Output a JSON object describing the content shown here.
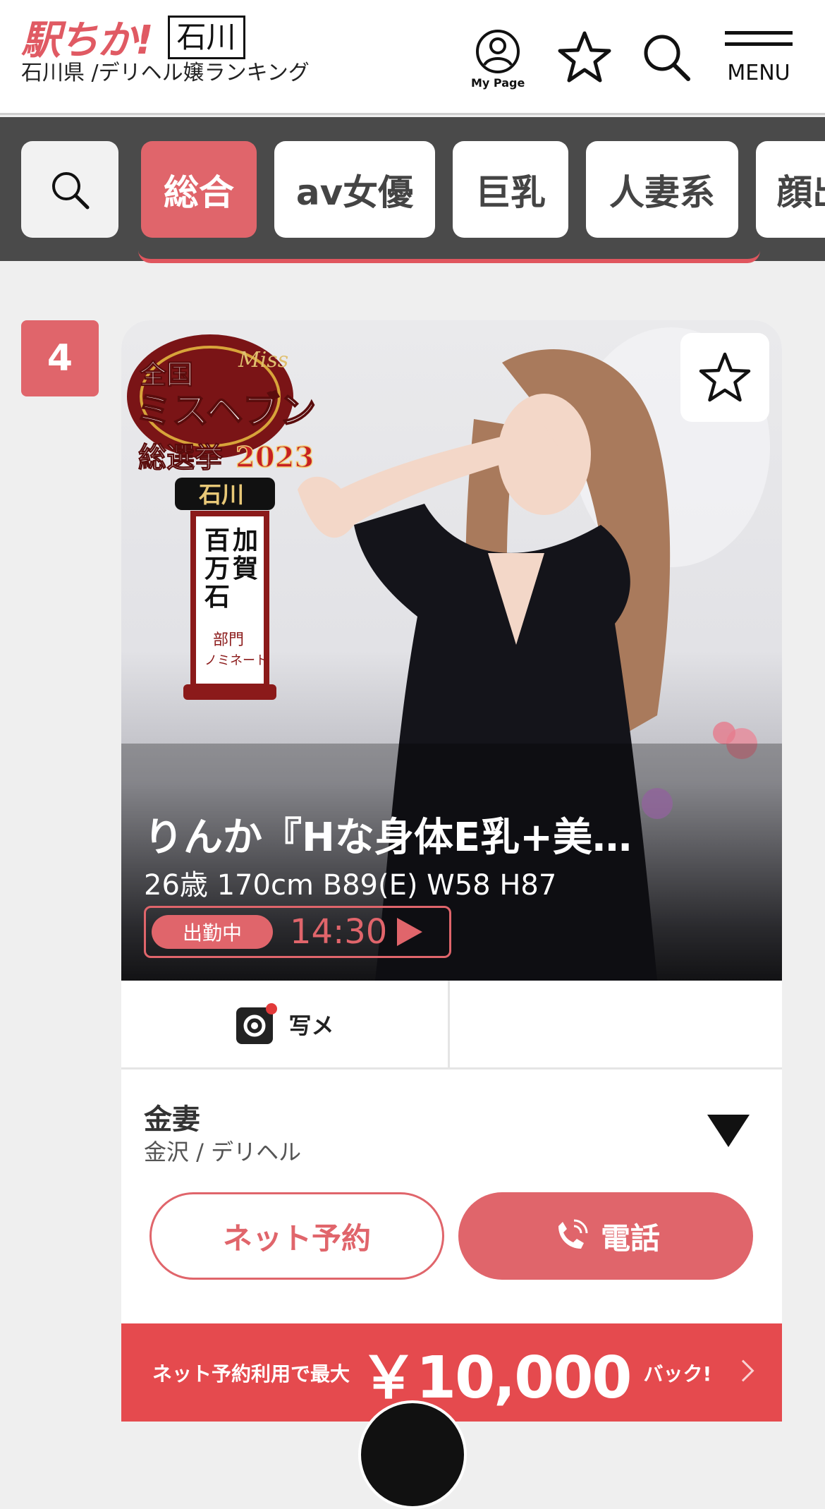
{
  "header": {
    "logo": "駅ちか!",
    "prefecture": "石川",
    "subtitle": "石川県 /デリヘル嬢ランキング",
    "mypage_label": "My Page",
    "menu_label": "MENU",
    "icons": [
      "user-circle-icon",
      "star-outline-icon",
      "search-icon",
      "hamburger-menu-icon"
    ]
  },
  "tabs": [
    {
      "label": "総合",
      "active": true
    },
    {
      "label": "av女優",
      "active": false
    },
    {
      "label": "巨乳",
      "active": false
    },
    {
      "label": "人妻系",
      "active": false
    },
    {
      "label": "顔出",
      "active": false
    }
  ],
  "ranking": {
    "rank": "4",
    "cast": {
      "name": "りんか『Hな身体E乳+美…",
      "spec": "26歳 170cm B89(E) W58 H87",
      "status_badge": "出勤中",
      "status_time": "14:30",
      "award_lines": [
        "全国",
        "ミスヘブン",
        "総選挙2023",
        "石川",
        "加賀",
        "百万石",
        "部門",
        "ノミネート"
      ],
      "award_logo_text": "Miss Heaven"
    },
    "photo_diary_label": "写メ",
    "shop": {
      "name": "金妻",
      "area": "金沢 / デリヘル"
    },
    "buttons": {
      "reserve": "ネット予約",
      "tel": "電話"
    },
    "banner": {
      "lead": "ネット予約利用で最大",
      "amount": "￥10,000",
      "tail": "バック!"
    }
  },
  "colors": {
    "accent": "#e0656b",
    "banner": "#e54a4e",
    "tabbar": "#4a4a4a",
    "page_bg": "#efefef"
  }
}
